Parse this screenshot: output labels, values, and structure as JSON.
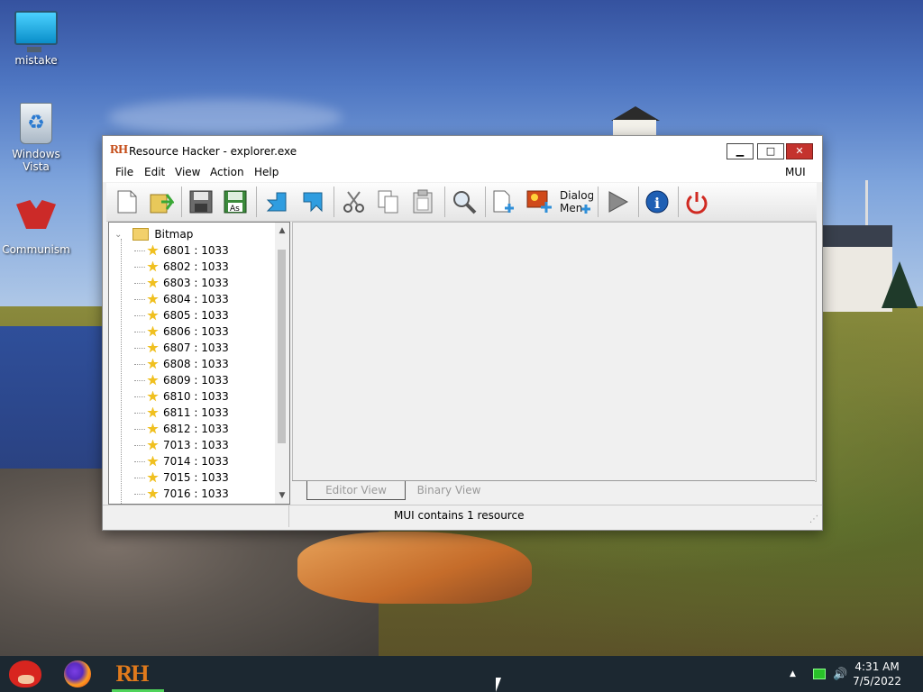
{
  "desktop": {
    "icons": [
      {
        "label": "mistake",
        "icon": "monitor-icon"
      },
      {
        "label": "Windows\nVista",
        "icon": "recycle-bin-icon"
      },
      {
        "label": "Communism",
        "icon": "flag-icon"
      }
    ]
  },
  "window": {
    "logo": "RH",
    "title": "Resource Hacker - explorer.exe",
    "controls": {
      "minimize": "▁",
      "maximize": "□",
      "close": "✕"
    }
  },
  "menu": {
    "items": [
      "File",
      "Edit",
      "View",
      "Action",
      "Help"
    ],
    "right_label": "MUI"
  },
  "toolbar": {
    "buttons": [
      "new-file-icon",
      "open-file-icon",
      "save-icon",
      "save-as-icon",
      "back-arrow-icon",
      "forward-arrow-icon",
      "cut-icon",
      "copy-icon",
      "paste-icon",
      "search-icon",
      "add-resource-icon",
      "add-image-icon",
      "dialog-menu-icon",
      "play-icon",
      "info-icon",
      "power-icon"
    ],
    "save_as_text": "As",
    "dialog_menu_text": "Dialog Men"
  },
  "tree": {
    "root": "Bitmap",
    "items": [
      "6801 : 1033",
      "6802 : 1033",
      "6803 : 1033",
      "6804 : 1033",
      "6805 : 1033",
      "6806 : 1033",
      "6807 : 1033",
      "6808 : 1033",
      "6809 : 1033",
      "6810 : 1033",
      "6811 : 1033",
      "6812 : 1033",
      "7013 : 1033",
      "7014 : 1033",
      "7015 : 1033",
      "7016 : 1033"
    ]
  },
  "tabs": {
    "editor_view": "Editor View",
    "binary_view": "Binary View"
  },
  "status": {
    "text": "MUI contains 1 resource"
  },
  "taskbar": {
    "apps": [
      "angry-birds-icon",
      "firefox-icon",
      "resource-hacker-icon"
    ],
    "rh_label": "RH",
    "tray": {
      "chevron": "▲",
      "volume": "🔊"
    },
    "clock": {
      "time": "4:31 AM",
      "date": "7/5/2022"
    }
  },
  "colors": {
    "close_button": "#c4332e",
    "taskbar": "#1c2831",
    "active_app_indicator": "#4fd35a"
  }
}
